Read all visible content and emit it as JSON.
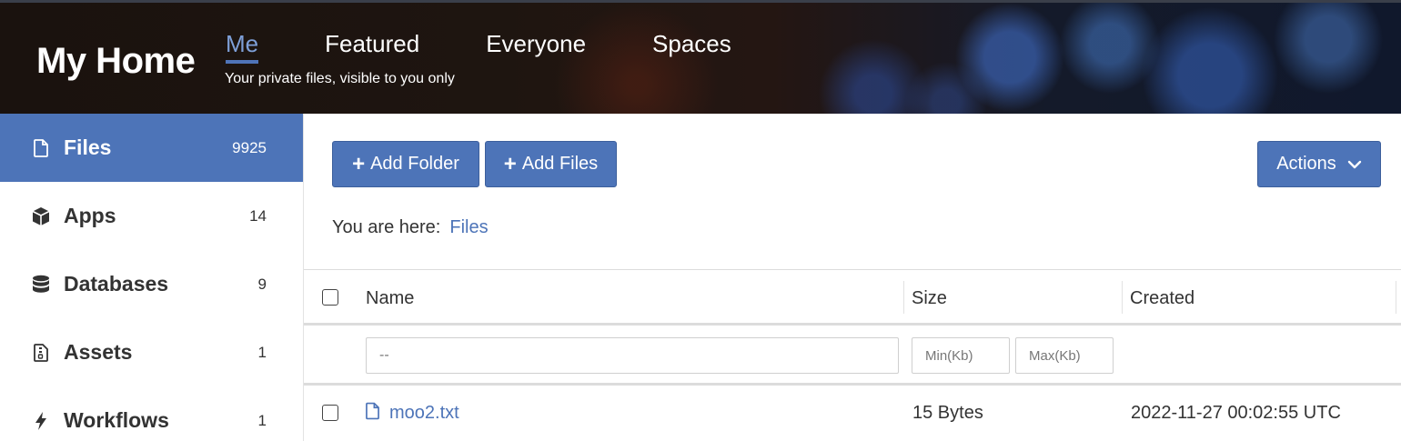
{
  "header": {
    "brand": "My Home",
    "tabs": [
      {
        "label": "Me",
        "active": true
      },
      {
        "label": "Featured",
        "active": false
      },
      {
        "label": "Everyone",
        "active": false
      },
      {
        "label": "Spaces",
        "active": false
      }
    ],
    "subtitle": "Your private files, visible to you only"
  },
  "sidebar": {
    "items": [
      {
        "label": "Files",
        "count": "9925",
        "icon": "file-icon",
        "active": true
      },
      {
        "label": "Apps",
        "count": "14",
        "icon": "cube-icon",
        "active": false
      },
      {
        "label": "Databases",
        "count": "9",
        "icon": "database-icon",
        "active": false
      },
      {
        "label": "Assets",
        "count": "1",
        "icon": "archive-icon",
        "active": false
      },
      {
        "label": "Workflows",
        "count": "1",
        "icon": "bolt-icon",
        "active": false
      }
    ]
  },
  "toolbar": {
    "add_folder": "Add Folder",
    "add_files": "Add Files",
    "actions": "Actions"
  },
  "breadcrumb": {
    "prefix": "You are here:",
    "current": "Files"
  },
  "table": {
    "columns": {
      "name": "Name",
      "size": "Size",
      "created": "Created"
    },
    "filters": {
      "name_placeholder": "--",
      "min_placeholder": "Min(Kb)",
      "max_placeholder": "Max(Kb)"
    },
    "rows": [
      {
        "name": "moo2.txt",
        "size": "15 Bytes",
        "created": "2022-11-27 00:02:55 UTC"
      }
    ]
  },
  "colors": {
    "accent": "#4d74b8",
    "header_bg": "#1a120e"
  }
}
